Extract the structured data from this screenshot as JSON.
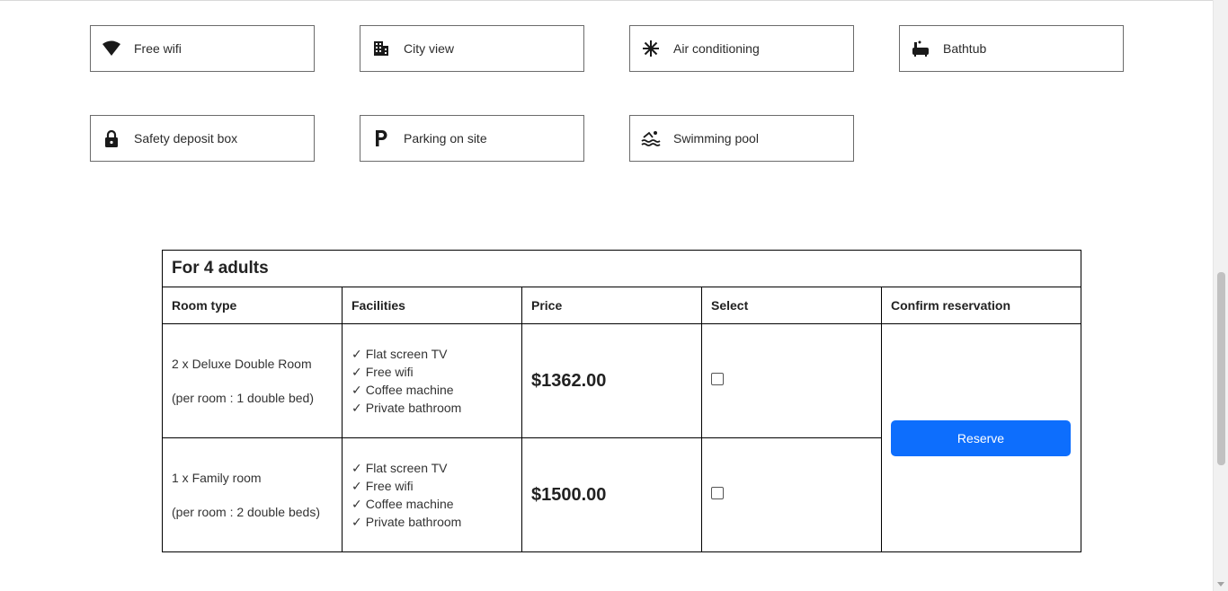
{
  "facilities": [
    {
      "label": "Free wifi",
      "icon": "wifi-icon"
    },
    {
      "label": "City view",
      "icon": "city-building-icon"
    },
    {
      "label": "Air conditioning",
      "icon": "snowflake-icon"
    },
    {
      "label": "Bathtub",
      "icon": "bathtub-icon"
    },
    {
      "label": "Safety deposit box",
      "icon": "lock-icon"
    },
    {
      "label": "Parking on site",
      "icon": "parking-icon"
    },
    {
      "label": "Swimming pool",
      "icon": "swimming-pool-icon"
    }
  ],
  "table": {
    "caption": "For 4 adults",
    "headers": [
      "Room type",
      "Facilities",
      "Price",
      "Select",
      "Confirm reservation"
    ],
    "rows": [
      {
        "room": "2 x Deluxe Double Room",
        "beds": "(per room : 1 double bed)",
        "facilities": [
          "Flat screen TV",
          "Free wifi",
          "Coffee machine",
          "Private bathroom"
        ],
        "price": "$1362.00",
        "selected": false
      },
      {
        "room": "1 x Family room",
        "beds": "(per room : 2 double beds)",
        "facilities": [
          "Flat screen TV",
          "Free wifi",
          "Coffee machine",
          "Private bathroom"
        ],
        "price": "$1500.00",
        "selected": false
      }
    ],
    "check_mark": "✓",
    "reserve_label": "Reserve"
  },
  "colors": {
    "accent": "#0d6efd",
    "border": "#000000",
    "facility_border": "#6b6b6b"
  }
}
